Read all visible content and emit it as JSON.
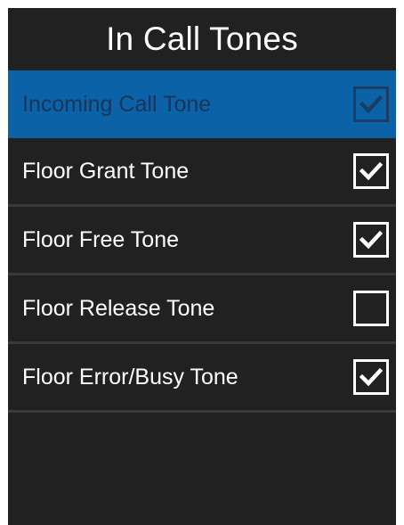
{
  "header": {
    "title": "In Call Tones"
  },
  "items": [
    {
      "label": "Incoming Call Tone",
      "checked": true,
      "selected": true
    },
    {
      "label": "Floor Grant Tone",
      "checked": true,
      "selected": false
    },
    {
      "label": "Floor Free Tone",
      "checked": true,
      "selected": false
    },
    {
      "label": "Floor Release Tone",
      "checked": false,
      "selected": false
    },
    {
      "label": "Floor Error/Busy Tone",
      "checked": true,
      "selected": false
    }
  ],
  "colors": {
    "background": "#212121",
    "selected": "#0b62a6",
    "divider": "#3a3a3a"
  }
}
